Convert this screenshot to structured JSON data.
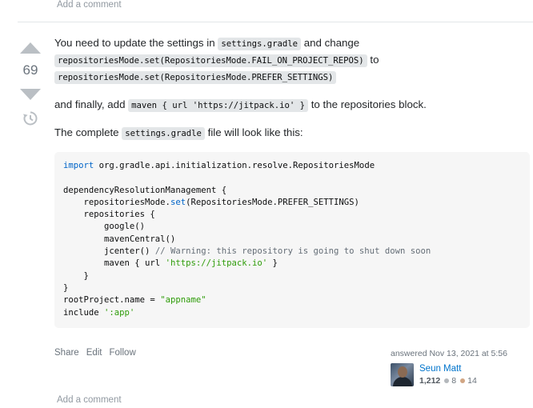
{
  "top_add_comment": "Add a comment",
  "vote": {
    "score": "69"
  },
  "body": {
    "p1_text_a": "You need to update the settings in",
    "p1_code_a": "settings.gradle",
    "p1_text_b": "and change",
    "p1_code_b": "repositoriesMode.set(RepositoriesMode.FAIL_ON_PROJECT_REPOS)",
    "p1_text_c": "to",
    "p1_code_c": "repositoriesMode.set(RepositoriesMode.PREFER_SETTINGS)",
    "p2_text_a": "and finally, add",
    "p2_code": "maven { url 'https://jitpack.io' }",
    "p2_text_b": "to the repositories block.",
    "p3_text_a": "The complete",
    "p3_code": "settings.gradle",
    "p3_text_b": "file will look like this:"
  },
  "code": {
    "l1_kw": "import",
    "l1_rest": " org.gradle.api.initialization.resolve.RepositoriesMode",
    "l3": "dependencyResolutionManagement {",
    "l4_a": "    repositoriesMode.",
    "l4_kw": "set",
    "l4_b": "(RepositoriesMode.PREFER_SETTINGS)",
    "l5": "    repositories {",
    "l6": "        google()",
    "l7": "        mavenCentral()",
    "l8_a": "        jcenter() ",
    "l8_cm": "// Warning: this repository is going to shut down soon",
    "l9_a": "        maven { url ",
    "l9_str": "'https://jitpack.io'",
    "l9_b": " }",
    "l10": "    }",
    "l11": "}",
    "l12_a": "rootProject.name = ",
    "l12_str": "\"appname\"",
    "l13_a": "include ",
    "l13_str": "':app'"
  },
  "menu": {
    "share": "Share",
    "edit": "Edit",
    "follow": "Follow"
  },
  "user": {
    "action": "answered Nov 13, 2021 at 5:56",
    "name": "Seun Matt",
    "reputation": "1,212",
    "silver": "8",
    "bronze": "14"
  },
  "bottom_add_comment": "Add a comment",
  "colors": {
    "link": "#0074cc",
    "keyword": "#0064c8",
    "string": "#2f9c0a",
    "comment": "#656e77"
  },
  "icons": {
    "upvote": "arrow-up-icon",
    "downvote": "arrow-down-icon",
    "history": "history-icon"
  }
}
